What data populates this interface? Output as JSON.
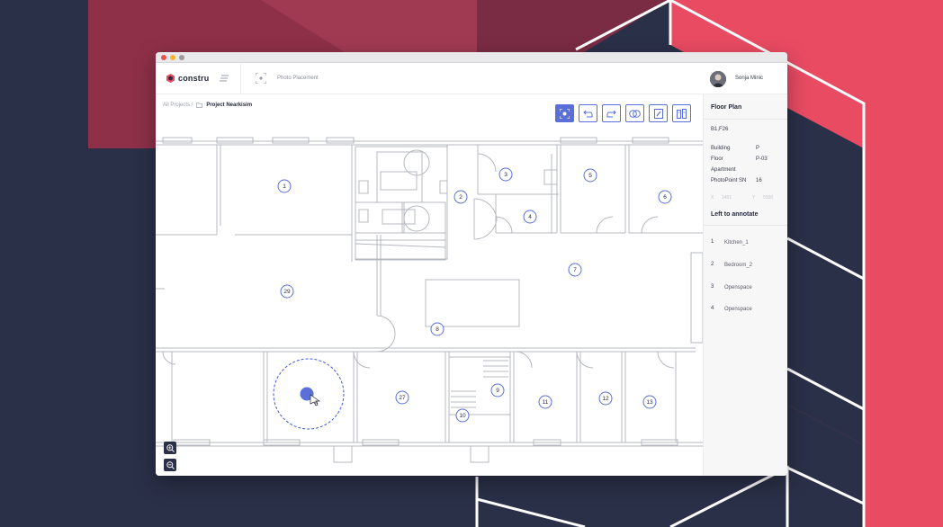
{
  "app": {
    "brand": "constru",
    "section": "Photo Placement",
    "user": "Sonja Minic"
  },
  "breadcrumb": {
    "all": "All Projects /",
    "project": "Project Nearkisim"
  },
  "toolbar": {
    "tools": [
      "photo-point-icon",
      "undo-icon",
      "redo-icon",
      "overlay-icon",
      "doc-edit-icon",
      "compare-icon"
    ],
    "active_index": 0
  },
  "floor_plan": {
    "points": [
      "1",
      "2",
      "3",
      "4",
      "5",
      "6",
      "7",
      "8",
      "9",
      "10",
      "11",
      "12",
      "13",
      "27",
      "29"
    ],
    "current_marker_badge": "34"
  },
  "panel": {
    "title": "Floor Plan",
    "code": "B1,F26",
    "fields": [
      {
        "label": "Building",
        "value": "P"
      },
      {
        "label": "Floor",
        "value": "P-03"
      },
      {
        "label": "Apartment",
        "value": ""
      },
      {
        "label": "PhotoPoint SN",
        "value": "16"
      }
    ],
    "x_label": "X",
    "x_value": "1451",
    "y_label": "Y",
    "y_value": "5500",
    "annotate_title": "Left to annotate",
    "annotations": [
      {
        "num": "1",
        "name": "Kitchen_1"
      },
      {
        "num": "2",
        "name": "Bedroom_2"
      },
      {
        "num": "3",
        "name": "Openspace"
      },
      {
        "num": "4",
        "name": "Openspace"
      }
    ]
  },
  "colors": {
    "accent": "#5a6fd8",
    "background_dark": "#2a3048",
    "background_red": "#e94b63",
    "background_maroon": "#8e3048"
  }
}
